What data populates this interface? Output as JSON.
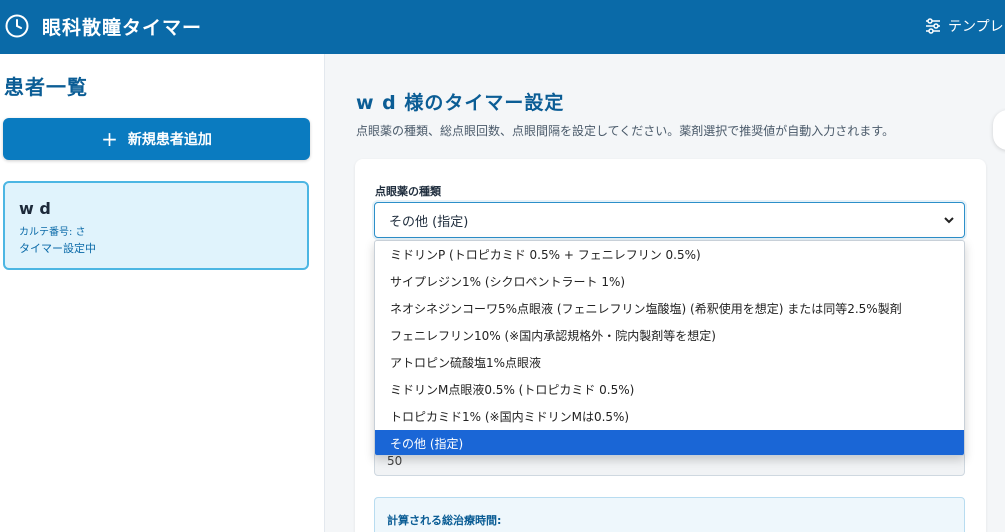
{
  "header": {
    "app_title": "眼科散瞳タイマー",
    "template_label": "テンプレート"
  },
  "sidebar": {
    "title": "患者一覧",
    "add_button": "新規患者追加",
    "patients": [
      {
        "name": "w d",
        "chart": "カルテ番号: さ",
        "status": "タイマー設定中"
      }
    ]
  },
  "main": {
    "title": "w d 様のタイマー設定",
    "description": "点眼薬の種類、総点眼回数、点眼間隔を設定してください。薬剤選択で推奨値が自動入力されます。",
    "drug_label": "点眼薬の種類",
    "drug_selected": "その他 (指定)",
    "drug_options": [
      "ミドリンP (トロピカミド 0.5% + フェニレフリン 0.5%)",
      "サイプレジン1% (シクロペントラート 1%)",
      "ネオシネジンコーワ5%点眼液 (フェニレフリン塩酸塩) (希釈使用を想定) または同等2.5%製剤",
      "フェニレフリン10% (※国内承認規格外・院内製剤等を想定)",
      "アトロピン硫酸塩1%点眼液",
      "ミドリンM点眼液0.5% (トロピカミド 0.5%)",
      "トロピカミド1% (※国内ミドリンMは0.5%)",
      "その他 (指定)"
    ],
    "interval_value": "50",
    "calc_label": "計算される総治療時間:"
  },
  "colors": {
    "header_bg": "#0a6aa8",
    "accent": "#0a7bc0",
    "selected_option": "#1a66d6"
  }
}
